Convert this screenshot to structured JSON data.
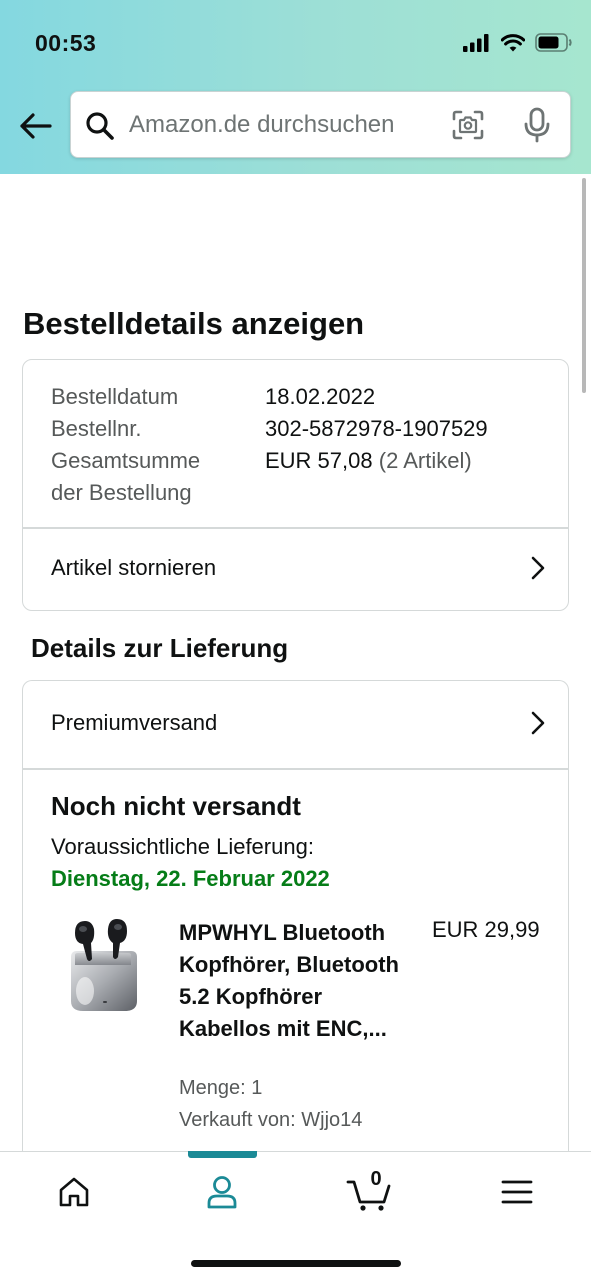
{
  "status_bar": {
    "time": "00:53"
  },
  "search": {
    "placeholder": "Amazon.de durchsuchen"
  },
  "page": {
    "title": "Bestelldetails anzeigen"
  },
  "order_summary": {
    "date_label": "Bestelldatum",
    "date_value": "18.02.2022",
    "number_label": "Bestellnr.",
    "number_value": "302-5872978-1907529",
    "total_label_line1": "Gesamtsumme",
    "total_label_line2": "der Bestellung",
    "total_value": "EUR 57,08",
    "total_items": "(2 Artikel)",
    "cancel_label": "Artikel stornieren"
  },
  "delivery": {
    "section_title": "Details zur Lieferung",
    "shipping_method": "Premiumversand",
    "status": "Noch nicht versandt",
    "expected_label": "Voraussichtliche Lieferung:",
    "expected_date": "Dienstag, 22. Februar 2022",
    "expected_date_color": "#067d18"
  },
  "product": {
    "title": "MPWHYL Bluetooth Kopfhörer, Bluetooth 5.2 Kopfhörer Kabellos mit ENC,...",
    "price": "EUR 29,99",
    "quantity": "Menge: 1",
    "seller": "Verkauft von: Wjjo14"
  },
  "bottom_nav": {
    "items": [
      "home-icon",
      "account-icon",
      "cart-icon",
      "menu-icon"
    ],
    "active": "account-icon",
    "active_color": "#1b8a96",
    "cart_count": "0"
  }
}
